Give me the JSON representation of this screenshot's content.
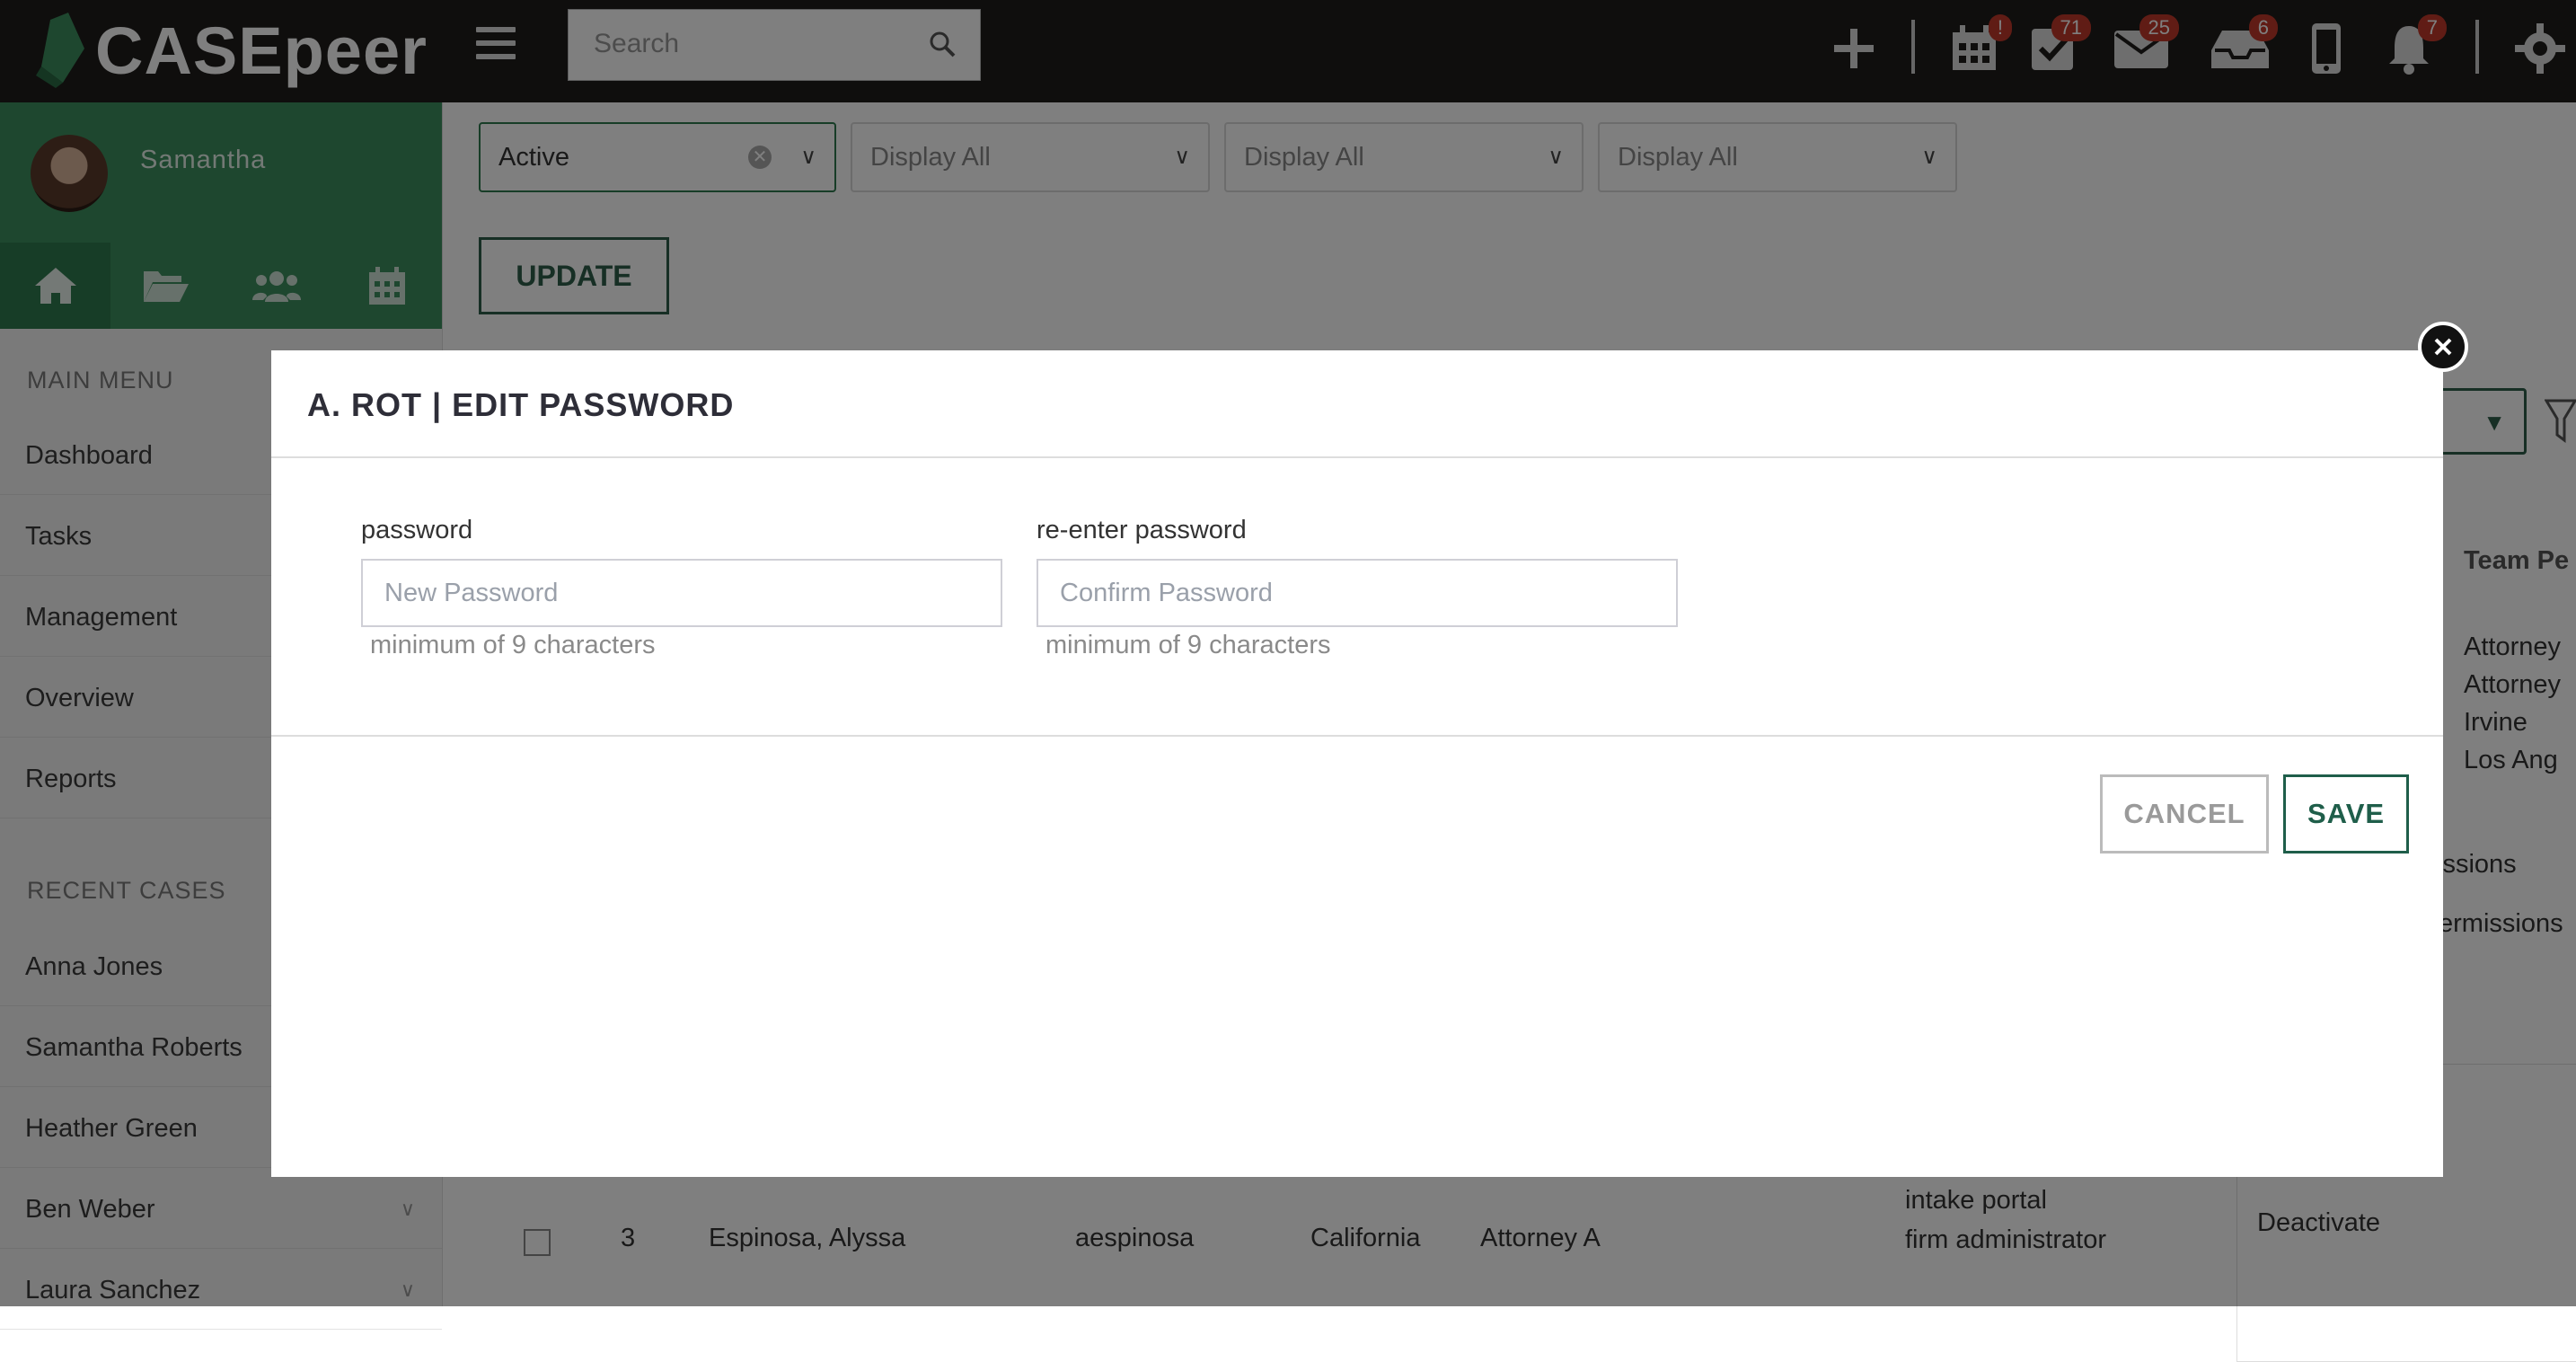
{
  "app": {
    "logo_text": "CASEpeer"
  },
  "topbar": {
    "search_placeholder": "Search",
    "badges": {
      "calendar": "!",
      "tasks": "71",
      "mail": "25",
      "inbox": "6",
      "notifications": "7"
    }
  },
  "sidebar": {
    "user_name": "Samantha",
    "main_menu_heading": "MAIN MENU",
    "main_menu": [
      "Dashboard",
      "Tasks",
      "Management",
      "Overview",
      "Reports"
    ],
    "recent_cases_heading": "RECENT CASES",
    "recent_cases": [
      "Anna Jones",
      "Samantha Roberts",
      "Heather Green",
      "Ben Weber",
      "Laura Sanchez"
    ]
  },
  "filters": {
    "status": "Active",
    "filter2": "Display All",
    "filter3": "Display All",
    "filter4": "Display All",
    "update_label": "UPDATE"
  },
  "background": {
    "column_team": "Team Pe",
    "team_values": [
      "Attorney",
      "Attorney",
      "Irvine",
      "Los Ang"
    ],
    "permissions_1": "issions",
    "permissions_2": "ermissions",
    "partial_s": "s",
    "deactivate": "Deactivate",
    "row": {
      "number": "3",
      "name": "Espinosa, Alyssa",
      "username": "aespinosa",
      "state": "California",
      "team": "Attorney A",
      "roles_line1": "intake portal",
      "roles_line2": "firm administrator"
    }
  },
  "modal": {
    "title": "A. ROT | EDIT PASSWORD",
    "password_label": "password",
    "password_placeholder": "New Password",
    "password_hint": "minimum of 9 characters",
    "reenter_label": "re-enter password",
    "reenter_placeholder": "Confirm Password",
    "reenter_hint": "minimum of 9 characters",
    "cancel_label": "CANCEL",
    "save_label": "SAVE"
  },
  "colors": {
    "brand_green": "#3c8f5e",
    "save_green": "#1f5e4a",
    "badge_red": "#c0392b",
    "topbar": "#1e1c1a"
  }
}
